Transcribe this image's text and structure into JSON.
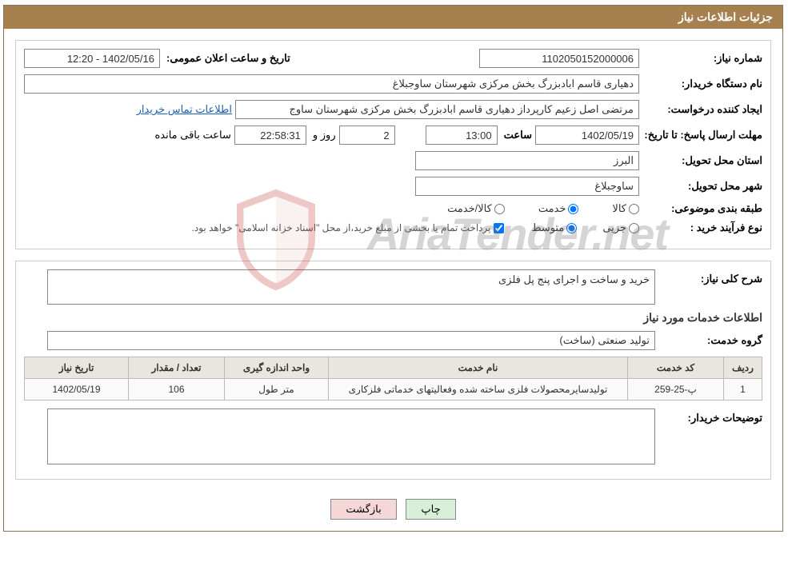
{
  "header": {
    "title": "جزئیات اطلاعات نیاز"
  },
  "info": {
    "need_no_label": "شماره نیاز:",
    "need_no": "1102050152000006",
    "pub_date_label": "تاریخ و ساعت اعلان عمومی:",
    "pub_date": "1402/05/16 - 12:20",
    "buyer_org_label": "نام دستگاه خریدار:",
    "buyer_org": "دهیاری قاسم ابادبزرگ بخش مرکزی شهرستان ساوجبلاغ",
    "requester_label": "ایجاد کننده درخواست:",
    "requester": "مرتضی اصل زعیم کارپرداز دهیاری قاسم ابادبزرگ بخش مرکزی شهرستان ساوج",
    "contact_link": "اطلاعات تماس خریدار",
    "deadline_label": "مهلت ارسال پاسخ:  تا تاریخ:",
    "deadline_date": "1402/05/19",
    "time_label": "ساعت",
    "deadline_time": "13:00",
    "days": "2",
    "and_label": "روز و",
    "remaining_time": "22:58:31",
    "remaining_label": "ساعت باقی مانده",
    "province_label": "استان محل تحویل:",
    "province": "البرز",
    "city_label": "شهر محل تحویل:",
    "city": "ساوجبلاغ",
    "category_label": "طبقه بندی موضوعی:",
    "cat_goods": "کالا",
    "cat_service": "خدمت",
    "cat_both": "کالا/خدمت",
    "proc_type_label": "نوع فرآیند خرید :",
    "proc_minor": "جزیی",
    "proc_medium": "متوسط",
    "payment_note": "پرداخت تمام یا بخشی از مبلغ خرید،از محل \"اسناد خزانه اسلامی\" خواهد بود."
  },
  "desc": {
    "title_label": "شرح کلی نیاز:",
    "title_text": "خرید و ساخت و اجرای پنج پل فلزی",
    "services_section": "اطلاعات خدمات مورد نیاز",
    "group_label": "گروه خدمت:",
    "group_text": "تولید صنعتی (ساخت)"
  },
  "table": {
    "headers": {
      "row": "ردیف",
      "code": "کد خدمت",
      "name": "نام خدمت",
      "unit": "واحد اندازه گیری",
      "qty": "تعداد / مقدار",
      "date": "تاریخ نیاز"
    },
    "rows": [
      {
        "row": "1",
        "code": "پ-25-259",
        "name": "تولیدسایرمحصولات فلزی ساخته شده وفعالیتهای خدماتی فلزکاری",
        "unit": "متر طول",
        "qty": "106",
        "date": "1402/05/19"
      }
    ]
  },
  "buyer_notes": {
    "label": "توضیحات خریدار:",
    "text": ""
  },
  "buttons": {
    "print": "چاپ",
    "back": "بازگشت"
  },
  "watermark": "AriaTender.net"
}
